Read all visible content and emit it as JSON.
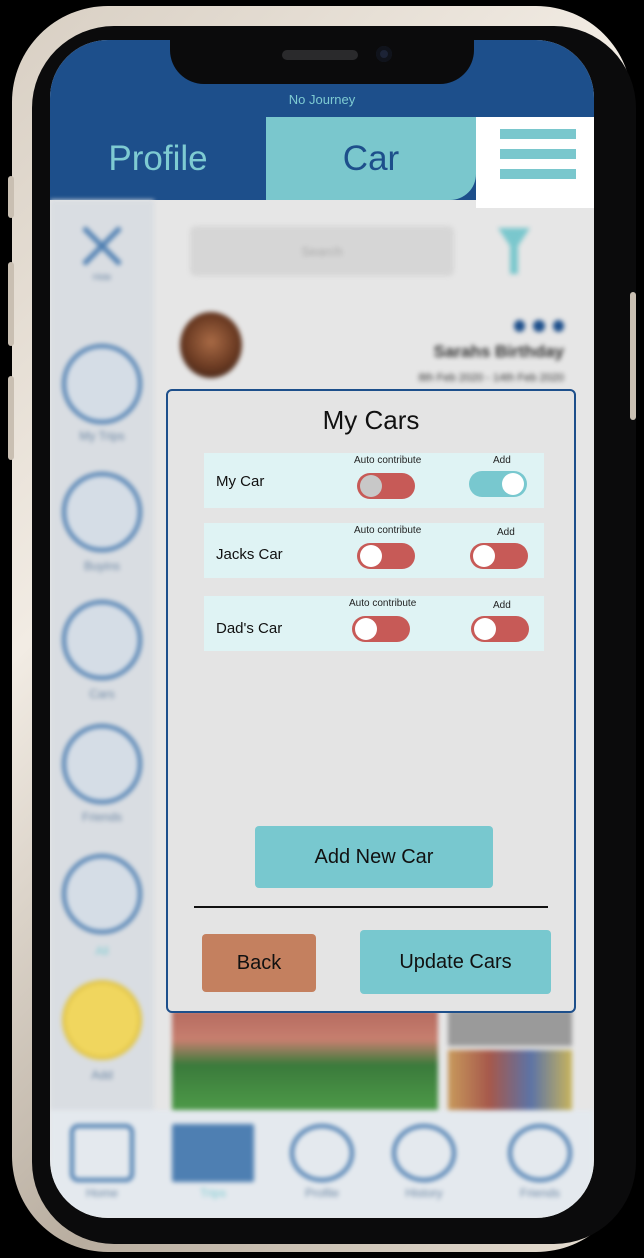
{
  "header": {
    "journey_label": "No Journey",
    "tabs": [
      {
        "label": "Profile"
      },
      {
        "label": "Car"
      }
    ]
  },
  "background": {
    "search_placeholder": "Search",
    "sidebar": [
      {
        "label": "Hide",
        "icon": "close-icon"
      },
      {
        "label": "My Trips",
        "icon": "image-icon"
      },
      {
        "label": "Buyins",
        "icon": "compass-icon"
      },
      {
        "label": "Cars",
        "icon": "car-icon"
      },
      {
        "label": "Friends",
        "icon": "friends-icon"
      },
      {
        "label": "All",
        "icon": "infinity-icon"
      },
      {
        "label": "Add",
        "icon": "plus-icon"
      }
    ],
    "event": {
      "title": "Sarahs Birthday",
      "dates": "8th Feb 2020 - 14th Feb 2020"
    },
    "bottom_nav": [
      {
        "label": "Home",
        "icon": "home-icon"
      },
      {
        "label": "Trips",
        "icon": "image-icon"
      },
      {
        "label": "Profile",
        "icon": "person-icon"
      },
      {
        "label": "History",
        "icon": "history-icon"
      },
      {
        "label": "Friends",
        "icon": "friends-icon"
      }
    ]
  },
  "modal": {
    "title": "My Cars",
    "auto_label": "Auto contribute",
    "add_label": "Add",
    "cars": [
      {
        "name": "My Car",
        "auto_contribute": false,
        "add": true
      },
      {
        "name": "Jacks Car",
        "auto_contribute": false,
        "add": false
      },
      {
        "name": "Dad's Car",
        "auto_contribute": false,
        "add": false
      }
    ],
    "add_new_car_label": "Add New Car",
    "back_label": "Back",
    "update_label": "Update Cars"
  },
  "colors": {
    "header_blue": "#1d4f8b",
    "accent_teal": "#78c8cf",
    "toggle_off": "#c75a57",
    "back_button": "#c4805f"
  }
}
